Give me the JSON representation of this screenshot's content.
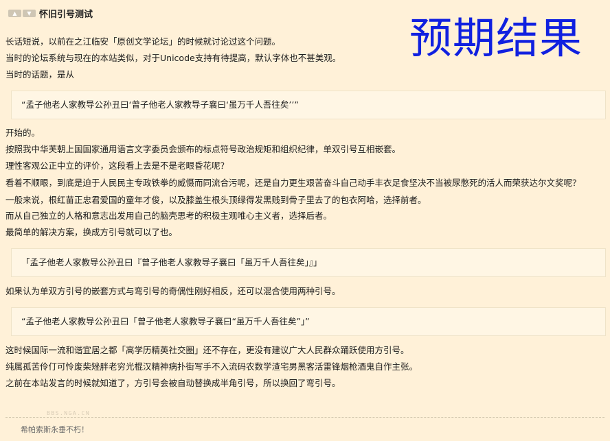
{
  "post": {
    "title": "怀旧引号测试",
    "thumb_up_icon": "thumb-up-icon",
    "thumb_down_icon": "thumb-down-icon",
    "watermark": "预期结果",
    "paragraphs_1": [
      "长话短说，以前在之江临安「原创文学论坛」的时候就讨论过这个问题。",
      "当时的论坛系统与现在的本站类似，对于Unicode支持有待提高，默认字体也不甚美观。",
      "当时的话题，是从"
    ],
    "quote_1": "“孟子他老人家教导公孙丑曰‘曾子他老人家教导子襄曰‘虽万千人吾往矣’’”",
    "paragraphs_2": [
      "开始的。",
      "按照我中华芙朝上国国家通用语言文字委员会颁布的标点符号政治规矩和组织纪律，单双引号互相嵌套。",
      "理性客观公正中立的评价，这段看上去是不是老眼昏花呢？",
      "看着不顺眼，到底是迫于人民民主专政铁拳的威慑而同流合污呢，还是自力更生艰苦奋斗自己动手丰衣足食坚决不当被尿憋死的活人而荣获达尔文奖呢？",
      "一般来说，根红苗正忠君爱国的童年才俊，以及膝盖生根头顶绿得发黑贱到骨子里去了的包衣阿哈，选择前者。",
      "而从自己独立的人格和意志出发用自己的脑壳思考的积极主观唯心主义者，选择后者。",
      "最简单的解决方案，换成方引号就可以了也。"
    ],
    "quote_2": "「孟子他老人家教导公孙丑曰『曾子他老人家教导子襄曰「虽万千人吾往矣」』」",
    "paragraphs_3": [
      "如果认为单双方引号的嵌套方式与弯引号的奇偶性刚好相反，还可以混合使用两种引号。"
    ],
    "quote_3": "“孟子他老人家教导公孙丑曰「曾子他老人家教导子襄曰“虽万千人吾往矣”」”",
    "paragraphs_4": [
      "这时候国际一流和谐宜居之都「高学历精英社交圈」还不存在，更没有建议广大人民群众踊跃使用方引号。",
      "纯属孤苦伶仃可怜废柴矬胖老穷光棍汉精神病扑街写手不入流码农数学渣宅男黑客活雷锋烟枪酒鬼自作主张。",
      "之前在本站发言的时候就知道了，方引号会被自动替换成半角引号，所以换回了弯引号。"
    ],
    "bbs_mark": "BBS.NGA.CN",
    "signature": "希帕索斯永垂不朽！"
  },
  "colors": {
    "background": "#fff1d8",
    "quote_background": "#fff6e4",
    "watermark": "#1020e0"
  }
}
